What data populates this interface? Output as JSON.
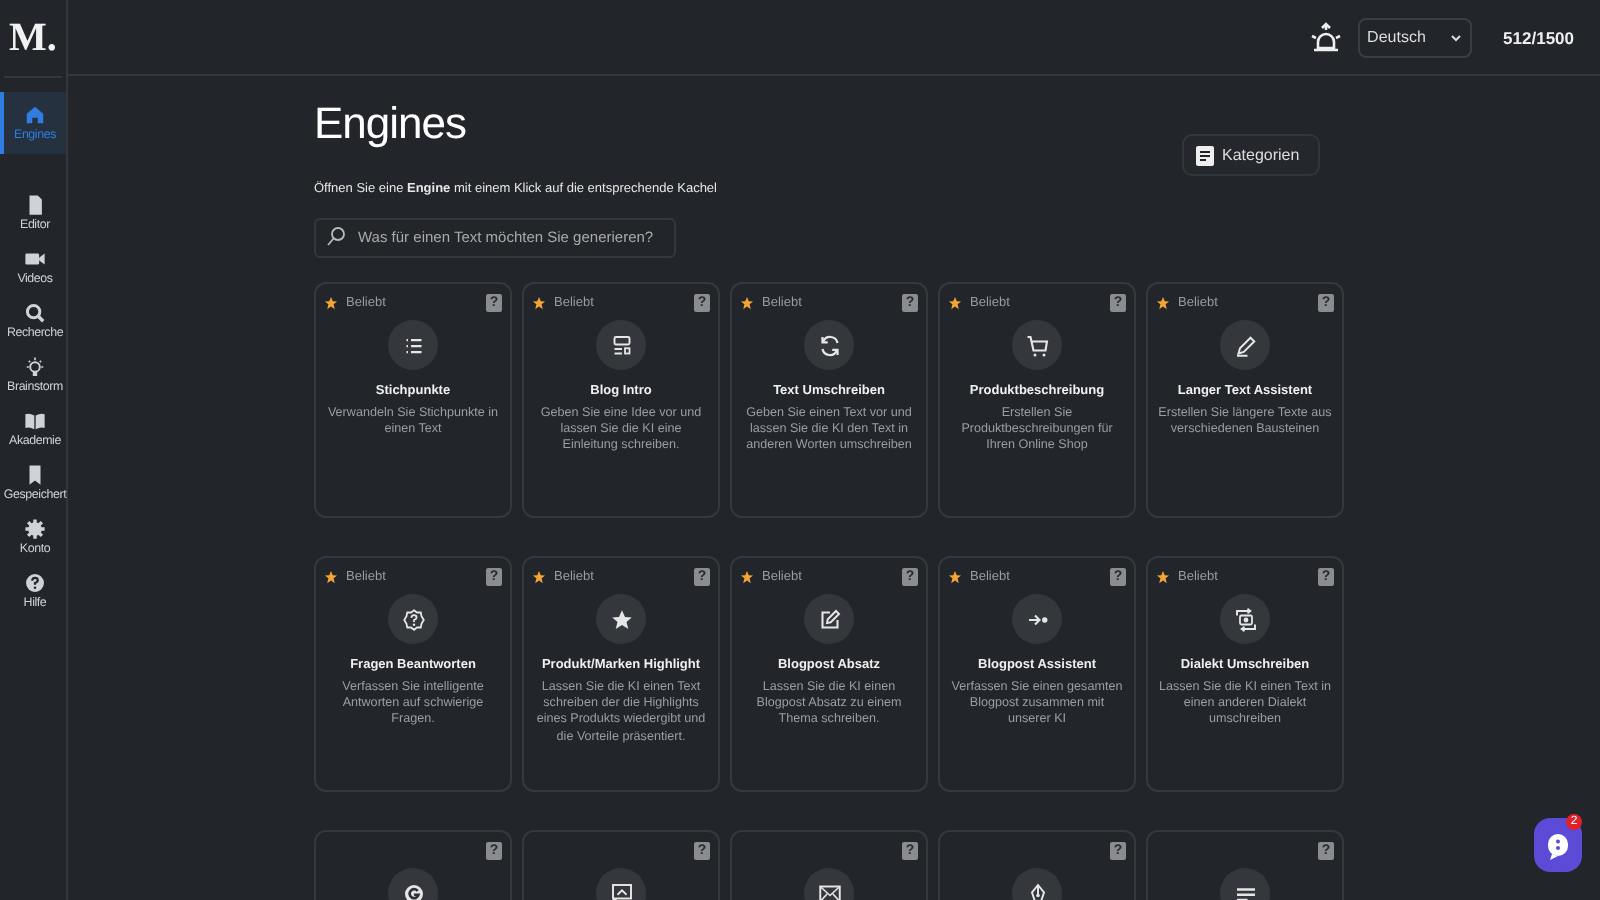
{
  "logo": "M.",
  "sidebar": {
    "items": [
      {
        "label": "Engines",
        "selected": true
      },
      {
        "label": "Editor",
        "selected": false
      },
      {
        "label": "Videos",
        "selected": false
      },
      {
        "label": "Recherche",
        "selected": false
      },
      {
        "label": "Brainstorm",
        "selected": false
      },
      {
        "label": "Akademie",
        "selected": false
      },
      {
        "label": "Gespeichert",
        "selected": false
      },
      {
        "label": "Konto",
        "selected": false
      },
      {
        "label": "Hilfe",
        "selected": false
      }
    ]
  },
  "topbar": {
    "language": "Deutsch",
    "credits": "512/1500"
  },
  "page": {
    "title": "Engines",
    "subtitle": "Öffnen Sie eine **Engine** mit einem Klick auf die entsprechende Kachel",
    "categories_button": "Kategorien",
    "search": {
      "placeholder": "Was für einen Text möchten Sie generieren?"
    }
  },
  "cards": [
    {
      "badge": "Beliebt",
      "help": "?",
      "title": "Stichpunkte",
      "description": "Verwandeln Sie Stichpunkte in einen Text"
    },
    {
      "badge": "Beliebt",
      "help": "?",
      "title": "Blog Intro",
      "description": "Geben Sie eine Idee vor und lassen Sie die KI eine Einleitung schreiben."
    },
    {
      "badge": "Beliebt",
      "help": "?",
      "title": "Text Umschreiben",
      "description": "Geben Sie einen Text vor und lassen Sie die KI den Text in anderen Worten umschreiben"
    },
    {
      "badge": "Beliebt",
      "help": "?",
      "title": "Produktbeschreibung",
      "description": "Erstellen Sie Produktbeschreibungen für Ihren Online Shop"
    },
    {
      "badge": "Beliebt",
      "help": "?",
      "title": "Langer Text Assistent",
      "description": "Erstellen Sie längere Texte aus verschiedenen Bausteinen"
    },
    {
      "badge": "Beliebt",
      "help": "?",
      "title": "Fragen Beantworten",
      "description": "Verfassen Sie intelligente Antworten auf schwierige Fragen."
    },
    {
      "badge": "Beliebt",
      "help": "?",
      "title": "Produkt/Marken Highlight",
      "description": "Lassen Sie die KI einen Text schreiben der die Highlights eines Produkts wiedergibt und die Vorteile präsentiert."
    },
    {
      "badge": "Beliebt",
      "help": "?",
      "title": "Blogpost Absatz",
      "description": "Lassen Sie die KI einen Blogpost Absatz zu einem Thema schreiben."
    },
    {
      "badge": "Beliebt",
      "help": "?",
      "title": "Blogpost Assistent",
      "description": "Verfassen Sie einen gesamten Blogpost zusammen mit unserer KI"
    },
    {
      "badge": "Beliebt",
      "help": "?",
      "title": "Dialekt Umschreiben",
      "description": "Lassen Sie die KI einen Text in einen anderen Dialekt umschreiben"
    },
    {
      "help": "?"
    },
    {
      "help": "?"
    },
    {
      "help": "?"
    },
    {
      "help": "?"
    },
    {
      "help": "?"
    }
  ],
  "chat": {
    "badge": "2"
  }
}
